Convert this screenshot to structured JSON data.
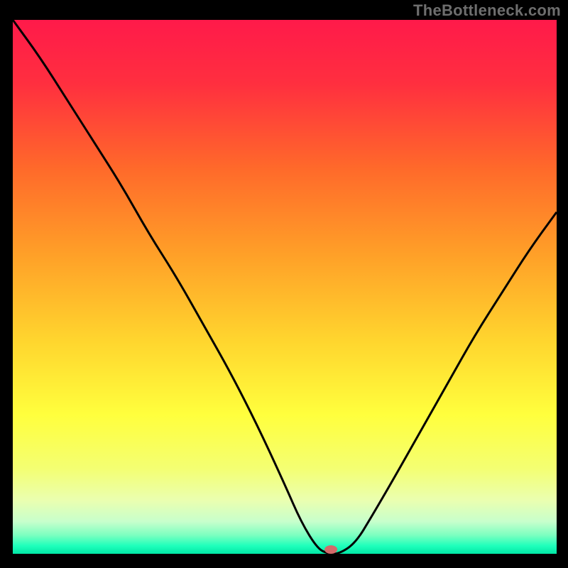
{
  "watermark": "TheBottleneck.com",
  "chart_data": {
    "type": "line",
    "title": "",
    "xlabel": "",
    "ylabel": "",
    "xlim": [
      0,
      100
    ],
    "ylim": [
      0,
      100
    ],
    "gradient_stops": [
      {
        "offset": 0.0,
        "color": "#ff1a4a"
      },
      {
        "offset": 0.12,
        "color": "#ff2f3f"
      },
      {
        "offset": 0.28,
        "color": "#ff6a2a"
      },
      {
        "offset": 0.44,
        "color": "#ffa028"
      },
      {
        "offset": 0.6,
        "color": "#ffd52e"
      },
      {
        "offset": 0.74,
        "color": "#ffff3d"
      },
      {
        "offset": 0.84,
        "color": "#f4ff72"
      },
      {
        "offset": 0.9,
        "color": "#eaffb0"
      },
      {
        "offset": 0.94,
        "color": "#c7ffcc"
      },
      {
        "offset": 0.965,
        "color": "#7cffc0"
      },
      {
        "offset": 0.985,
        "color": "#1fffbb"
      },
      {
        "offset": 1.0,
        "color": "#00e8a6"
      }
    ],
    "series": [
      {
        "name": "bottleneck-curve",
        "x": [
          0,
          5,
          10,
          15,
          20,
          25,
          30,
          35,
          40,
          45,
          50,
          53,
          56,
          58,
          60,
          63,
          66,
          70,
          75,
          80,
          85,
          90,
          95,
          100
        ],
        "y": [
          100,
          93,
          85,
          77,
          69,
          60,
          52,
          43,
          34,
          24,
          13,
          6,
          1,
          0,
          0,
          2,
          7,
          14,
          23,
          32,
          41,
          49,
          57,
          64
        ]
      }
    ],
    "marker": {
      "x": 58.5,
      "y": 0.8,
      "color": "#d36a6a"
    }
  }
}
